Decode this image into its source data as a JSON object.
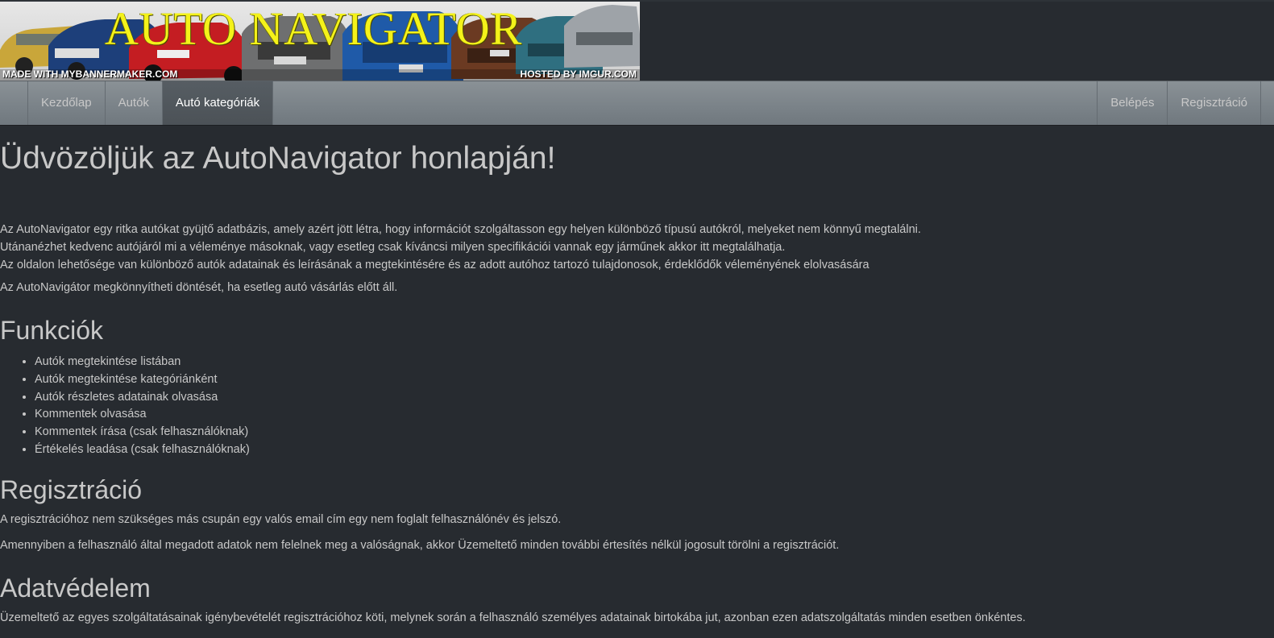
{
  "banner": {
    "title": "AUTO NAVIGATOR",
    "caption_left": "MADE WITH MYBANNERMAKER.COM",
    "caption_right": "HOSTED BY IMGUR.COM"
  },
  "nav": {
    "left": [
      {
        "label": "Kezdőlap",
        "active": false
      },
      {
        "label": "Autók",
        "active": false
      },
      {
        "label": "Autó kategóriák",
        "active": true
      }
    ],
    "right": [
      {
        "label": "Belépés"
      },
      {
        "label": "Regisztráció"
      }
    ]
  },
  "main": {
    "heading": "Üdvözöljük az AutoNavigator honlapján!",
    "intro": [
      "Az AutoNavigator egy ritka autókat gyüjtő adatbázis, amely azért jött létra, hogy információt szolgáltasson egy helyen különböző típusú autókról, melyeket nem könnyű megtalálni.",
      "Utánanézhet kedvenc autójáról mi a véleménye másoknak, vagy esetleg csak kíváncsi milyen specifikációi vannak egy járműnek akkor itt megtalálhatja.",
      "Az oldalon lehetősége van különböző autók adatainak és leírásának a megtekintésére és az adott autóhoz tartozó tulajdonosok, érdeklődők véleményének elolvasására"
    ],
    "intro_last": "Az AutoNavigátor megkönnyítheti döntését, ha esetleg autó vásárlás előtt áll.",
    "functions": {
      "heading": "Funkciók",
      "items": [
        "Autók megtekintése listában",
        "Autók megtekintése kategóriánként",
        "Autók részletes adatainak olvasása",
        "Kommentek olvasása",
        "Kommentek írása (csak felhasználóknak)",
        "Értékelés leadása (csak felhasználóknak)"
      ]
    },
    "registration": {
      "heading": "Regisztráció",
      "p1": "A regisztrációhoz nem szükséges más csupán egy valós email cím egy nem foglalt felhasználónév és jelszó.",
      "p2": "Amennyiben a felhasználó által megadott adatok nem felelnek meg a valóságnak, akkor Üzemeltető minden további értesítés nélkül jogosult törölni a regisztrációt."
    },
    "privacy": {
      "heading": "Adatvédelem",
      "p1": "Üzemeltető az egyes szolgáltatásainak igénybevételét regisztrációhoz köti, melynek során a felhasználó személyes adatainak birtokába jut, azonban ezen adatszolgáltatás minden esetben önkéntes."
    }
  },
  "colors": {
    "background": "#272b30",
    "text": "#c8c8c8",
    "navbar": "#7a8288",
    "banner_title": "#f4f21a"
  }
}
